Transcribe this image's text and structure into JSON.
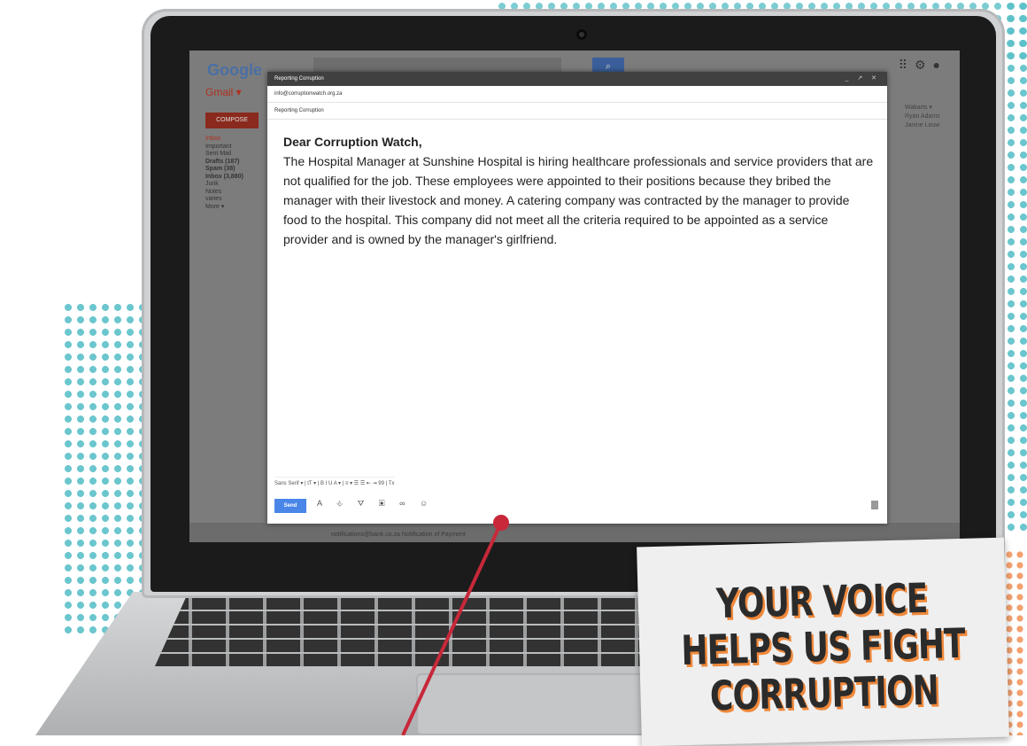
{
  "gmail": {
    "logo": "Google",
    "label": "Gmail ▾",
    "compose_label": "COMPOSE",
    "folders": [
      "Inbox",
      "Important",
      "Sent Mail",
      "Drafts (187)",
      "Spam (38)",
      "Inbox (3,880)",
      "Junk",
      "Notes",
      "varies",
      "More ▾"
    ],
    "right_items": [
      "Wakarts ▾",
      "Ryan Adams",
      "Janine Louw"
    ],
    "search_icon": "search-icon",
    "top_icons": [
      "apps-icon",
      "settings-icon",
      "avatar"
    ],
    "bottom_row": "notifications@bank.co.za  Notification of Payment"
  },
  "compose": {
    "window_title": "Reporting Corruption",
    "window_controls": "_ ↗ ✕",
    "to": "info@corruptionwatch.org.za",
    "subject": "Reporting Corruption",
    "greeting": "Dear Corruption Watch,",
    "body": "The Hospital Manager at Sunshine Hospital is hiring healthcare professionals and service providers that are not qualified for the job. These employees were appointed to their positions because they bribed the manager with their livestock and money. A catering company was contracted by the manager to provide food to the hospital. This company did not meet all the criteria required to be appointed as a service provider and is owned by the manager's girlfriend.",
    "format_bar": "Sans Serif  ▾  |  tT ▾  |  B  I  U  A ▾  |  ≡ ▾  ☰  ☰  ⇤  ⇥  99  |  Tx",
    "send_label": "Send",
    "send_icons": "A  ⎀  ⛛  ▣  ∞  ☺"
  },
  "callout": {
    "text": "YOUR VOICE\nHELPS US FIGHT\nCORRUPTION"
  },
  "colors": {
    "accent_orange": "#f0893b",
    "teal": "#5bc0c8",
    "pointer_red": "#c8283a",
    "send_blue": "#4a86e8"
  }
}
